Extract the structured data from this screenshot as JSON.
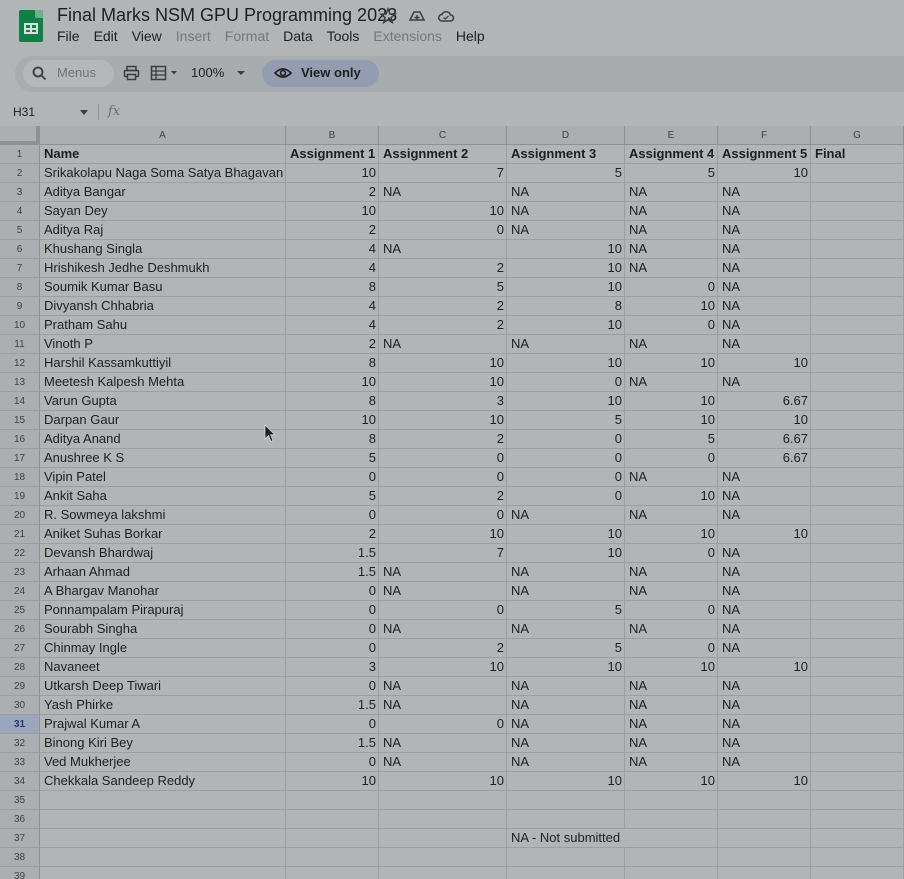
{
  "doc": {
    "title": "Final Marks NSM GPU Programming 2023"
  },
  "menu": [
    {
      "label": "File",
      "enabled": true
    },
    {
      "label": "Edit",
      "enabled": true
    },
    {
      "label": "View",
      "enabled": true
    },
    {
      "label": "Insert",
      "enabled": false
    },
    {
      "label": "Format",
      "enabled": false
    },
    {
      "label": "Data",
      "enabled": true
    },
    {
      "label": "Tools",
      "enabled": true
    },
    {
      "label": "Extensions",
      "enabled": false
    },
    {
      "label": "Help",
      "enabled": true
    }
  ],
  "toolbar": {
    "search_placeholder": "Menus",
    "zoom": "100%",
    "view_only_label": "View only"
  },
  "formula_bar": {
    "cell_ref": "H31",
    "fx": "fx"
  },
  "columns": [
    "A",
    "B",
    "C",
    "D",
    "E",
    "F",
    "G"
  ],
  "rows": [
    [
      "Name",
      "Assignment 1",
      "Assignment 2",
      "Assignment 3",
      "Assignment 4",
      "Assignment 5",
      "Final"
    ],
    [
      "Srikakolapu Naga Soma Satya Bhagavan",
      "10",
      "7",
      "5",
      "5",
      "10",
      ""
    ],
    [
      "Aditya Bangar",
      "2",
      "NA",
      "NA",
      "NA",
      "NA",
      ""
    ],
    [
      "Sayan Dey",
      "10",
      "10",
      "NA",
      "NA",
      "NA",
      ""
    ],
    [
      "Aditya Raj",
      "2",
      "0",
      "NA",
      "NA",
      "NA",
      ""
    ],
    [
      "Khushang Singla",
      "4",
      "NA",
      "10",
      "NA",
      "NA",
      ""
    ],
    [
      "Hrishikesh Jedhe Deshmukh",
      "4",
      "2",
      "10",
      "NA",
      "NA",
      ""
    ],
    [
      "Soumik Kumar Basu",
      "8",
      "5",
      "10",
      "0",
      "NA",
      ""
    ],
    [
      "Divyansh Chhabria",
      "4",
      "2",
      "8",
      "10",
      "NA",
      ""
    ],
    [
      "Pratham Sahu",
      "4",
      "2",
      "10",
      "0",
      "NA",
      ""
    ],
    [
      "Vinoth P",
      "2",
      "NA",
      "NA",
      "NA",
      "NA",
      ""
    ],
    [
      "Harshil Kassamkuttiyil",
      "8",
      "10",
      "10",
      "10",
      "10",
      ""
    ],
    [
      "Meetesh Kalpesh Mehta",
      "10",
      "10",
      "0",
      "NA",
      "NA",
      ""
    ],
    [
      "Varun Gupta",
      "8",
      "3",
      "10",
      "10",
      "6.67",
      ""
    ],
    [
      "Darpan Gaur",
      "10",
      "10",
      "5",
      "10",
      "10",
      ""
    ],
    [
      "Aditya Anand",
      "8",
      "2",
      "0",
      "5",
      "6.67",
      ""
    ],
    [
      "Anushree K S",
      "5",
      "0",
      "0",
      "0",
      "6.67",
      ""
    ],
    [
      "Vipin Patel",
      "0",
      "0",
      "0",
      "NA",
      "NA",
      ""
    ],
    [
      "Ankit Saha",
      "5",
      "2",
      "0",
      "10",
      "NA",
      ""
    ],
    [
      "R. Sowmeya lakshmi",
      "0",
      "0",
      "NA",
      "NA",
      "NA",
      ""
    ],
    [
      "Aniket Suhas Borkar",
      "2",
      "10",
      "10",
      "10",
      "10",
      ""
    ],
    [
      "Devansh Bhardwaj",
      "1.5",
      "7",
      "10",
      "0",
      "NA",
      ""
    ],
    [
      "Arhaan Ahmad",
      "1.5",
      "NA",
      "NA",
      "NA",
      "NA",
      ""
    ],
    [
      "A Bhargav Manohar",
      "0",
      "NA",
      "NA",
      "NA",
      "NA",
      ""
    ],
    [
      "Ponnampalam Pirapuraj",
      "0",
      "0",
      "5",
      "0",
      "NA",
      ""
    ],
    [
      "Sourabh Singha",
      "0",
      "NA",
      "NA",
      "NA",
      "NA",
      ""
    ],
    [
      "Chinmay Ingle",
      "0",
      "2",
      "5",
      "0",
      "NA",
      ""
    ],
    [
      "Navaneet",
      "3",
      "10",
      "10",
      "10",
      "10",
      ""
    ],
    [
      "Utkarsh Deep Tiwari",
      "0",
      "NA",
      "NA",
      "NA",
      "NA",
      ""
    ],
    [
      "Yash Phirke",
      "1.5",
      "NA",
      "NA",
      "NA",
      "NA",
      ""
    ],
    [
      "Prajwal Kumar A",
      "0",
      "0",
      "NA",
      "NA",
      "NA",
      ""
    ],
    [
      "Binong Kiri Bey",
      "1.5",
      "NA",
      "NA",
      "NA",
      "NA",
      ""
    ],
    [
      "Ved Mukherjee",
      "0",
      "NA",
      "NA",
      "NA",
      "NA",
      ""
    ],
    [
      "Chekkala Sandeep Reddy",
      "10",
      "10",
      "10",
      "10",
      "10",
      ""
    ],
    [
      "",
      "",
      "",
      "",
      "",
      "",
      ""
    ],
    [
      "",
      "",
      "",
      "",
      "",
      "",
      ""
    ],
    [
      "",
      "",
      "",
      "NA - Not submitted",
      "",
      "",
      ""
    ],
    [
      "",
      "",
      "",
      "",
      "",
      "",
      ""
    ],
    [
      "",
      "",
      "",
      "",
      "",
      "",
      ""
    ]
  ],
  "selected_row": "31"
}
